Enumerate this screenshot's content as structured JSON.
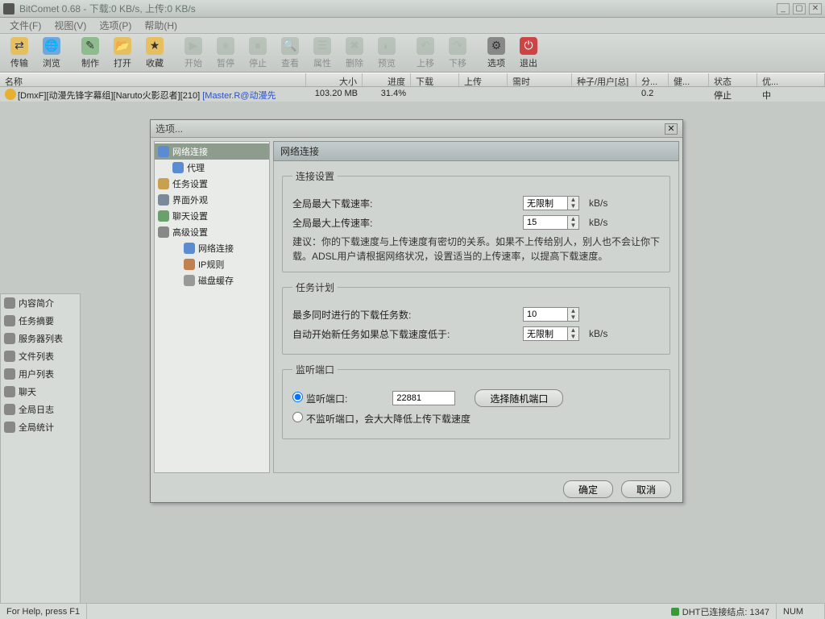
{
  "window": {
    "title": "BitComet 0.68 - 下载:0 KB/s, 上传:0 KB/s"
  },
  "menu": {
    "file": "文件(F)",
    "view": "视图(V)",
    "options": "选项(P)",
    "help": "帮助(H)"
  },
  "toolbar": {
    "transfer": "传输",
    "browse": "浏览",
    "make": "制作",
    "open": "打开",
    "fav": "收藏",
    "start": "开始",
    "pause": "暂停",
    "stop": "停止",
    "search": "查看",
    "props": "属性",
    "delete": "删除",
    "preview": "预览",
    "up": "上移",
    "down": "下移",
    "opts": "选项",
    "exit": "退出"
  },
  "columns": {
    "name": "名称",
    "size": "大小",
    "progress": "进度",
    "download": "下载",
    "upload": "上传",
    "time": "需时",
    "seed": "种子/用户[总]",
    "share": "分...",
    "health": "健...",
    "status": "状态",
    "priority": "优..."
  },
  "row": {
    "name": "[DmxF][动漫先锋字幕组][Naruto火影忍者][210]",
    "link": "[Master.R@动漫先",
    "size": "103.20 MB",
    "progress": "31.4%",
    "share": "0.2",
    "status": "停止",
    "priority": "中"
  },
  "side": {
    "summary": "内容简介",
    "tasks": "任务摘要",
    "servers": "服务器列表",
    "files": "文件列表",
    "users": "用户列表",
    "chat": "聊天",
    "log": "全局日志",
    "stats": "全局统计"
  },
  "statusbar": {
    "help": "For Help, press F1",
    "dht": "DHT已连接结点: 1347",
    "num": "NUM"
  },
  "dialog": {
    "title": "选项...",
    "tree": {
      "net": "网络连接",
      "proxy": "代理",
      "task": "任务设置",
      "ui": "界面外观",
      "chat": "聊天设置",
      "adv": "高级设置",
      "adv_net": "网络连接",
      "adv_ip": "IP规则",
      "adv_disk": "磁盘缓存"
    },
    "panel_title": "网络连接",
    "fs_conn": {
      "legend": "连接设置",
      "dl_label": "全局最大下载速率:",
      "dl_val": "无限制",
      "dl_unit": "kB/s",
      "ul_label": "全局最大上传速率:",
      "ul_val": "15",
      "ul_unit": "kB/s",
      "hint": "建议：你的下载速度与上传速度有密切的关系。如果不上传给别人，别人也不会让你下载。ADSL用户请根据网络状况，设置适当的上传速率，以提高下载速度。"
    },
    "fs_plan": {
      "legend": "任务计划",
      "max_label": "最多同时进行的下载任务数:",
      "max_val": "10",
      "auto_label": "自动开始新任务如果总下载速度低于:",
      "auto_val": "无限制",
      "auto_unit": "kB/s"
    },
    "fs_port": {
      "legend": "监听端口",
      "listen_label": "监听端口:",
      "port_val": "22881",
      "rand_btn": "选择随机端口",
      "nolisten_label": "不监听端口，会大大降低上传下载速度"
    },
    "ok": "确定",
    "cancel": "取消"
  }
}
